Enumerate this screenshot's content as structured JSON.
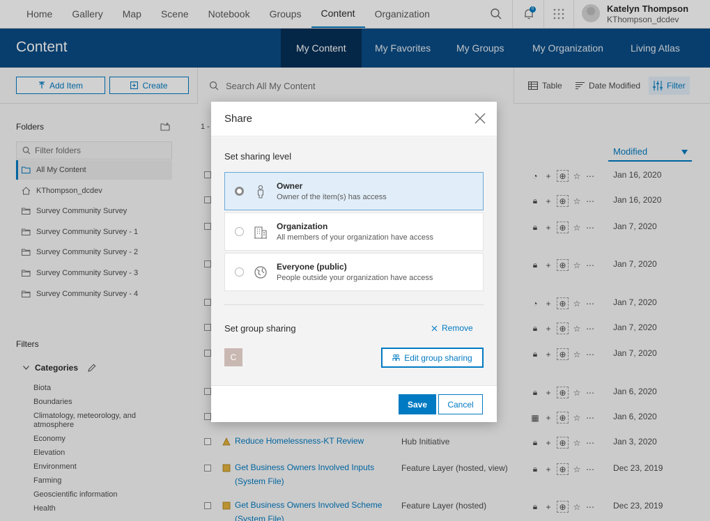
{
  "topnav": {
    "links": [
      "Home",
      "Gallery",
      "Map",
      "Scene",
      "Notebook",
      "Groups",
      "Content",
      "Organization"
    ],
    "active": "Content",
    "notification_count": "0",
    "user_name": "Katelyn Thompson",
    "user_handle": "KThompson_dcdev"
  },
  "header": {
    "title": "Content",
    "tabs": [
      "My Content",
      "My Favorites",
      "My Groups",
      "My Organization",
      "Living Atlas"
    ]
  },
  "toolbar": {
    "add_item": "Add Item",
    "create": "Create",
    "search_placeholder": "Search All My Content",
    "view": "Table",
    "sort": "Date Modified",
    "filter": "Filter"
  },
  "sidebar": {
    "folders_heading": "Folders",
    "filter_placeholder": "Filter folders",
    "folders": [
      "All My Content",
      "KThompson_dcdev",
      "Survey Community Survey",
      "Survey Community Survey - 1",
      "Survey Community Survey - 2",
      "Survey Community Survey - 3",
      "Survey Community Survey - 4"
    ],
    "filters_heading": "Filters",
    "categories_heading": "Categories",
    "categories": [
      "Biota",
      "Boundaries",
      "Climatology, meteorology, and atmosphere",
      "Economy",
      "Elevation",
      "Environment",
      "Farming",
      "Geoscientific information",
      "Health"
    ]
  },
  "content": {
    "count_prefix": "1 -",
    "modified_header": "Modified",
    "dates": [
      "Jan 16, 2020",
      "Jan 16, 2020",
      "Jan 7, 2020",
      "Jan 7, 2020",
      "Jan 7, 2020",
      "Jan 7, 2020",
      "Jan 7, 2020",
      "Jan 6, 2020",
      "Jan 6, 2020",
      "Jan 3, 2020",
      "Dec 23, 2019",
      "Dec 23, 2019"
    ],
    "visible_items": [
      {
        "title": "Reduce Homelessness-KT Review",
        "type": "Hub Initiative"
      },
      {
        "title": "Get Business Owners Involved Inputs (System File)",
        "type": "Feature Layer (hosted, view)"
      },
      {
        "title": "Get Business Owners Involved Scheme (System File)",
        "type": "Feature Layer (hosted)"
      }
    ]
  },
  "share_dialog": {
    "title": "Share",
    "sharing_level_label": "Set sharing level",
    "options": [
      {
        "title": "Owner",
        "desc": "Owner of the item(s) has access"
      },
      {
        "title": "Organization",
        "desc": "All members of your organization have access"
      },
      {
        "title": "Everyone (public)",
        "desc": "People outside your organization have access"
      }
    ],
    "selected": "Owner",
    "group_sharing_label": "Set group sharing",
    "remove": "Remove",
    "group_initial": "C",
    "edit_group_sharing": "Edit group sharing",
    "save": "Save",
    "cancel": "Cancel"
  },
  "colors": {
    "brand_blue": "#007ac2",
    "header_blue": "#0a4c86",
    "header_active": "#062f57"
  }
}
